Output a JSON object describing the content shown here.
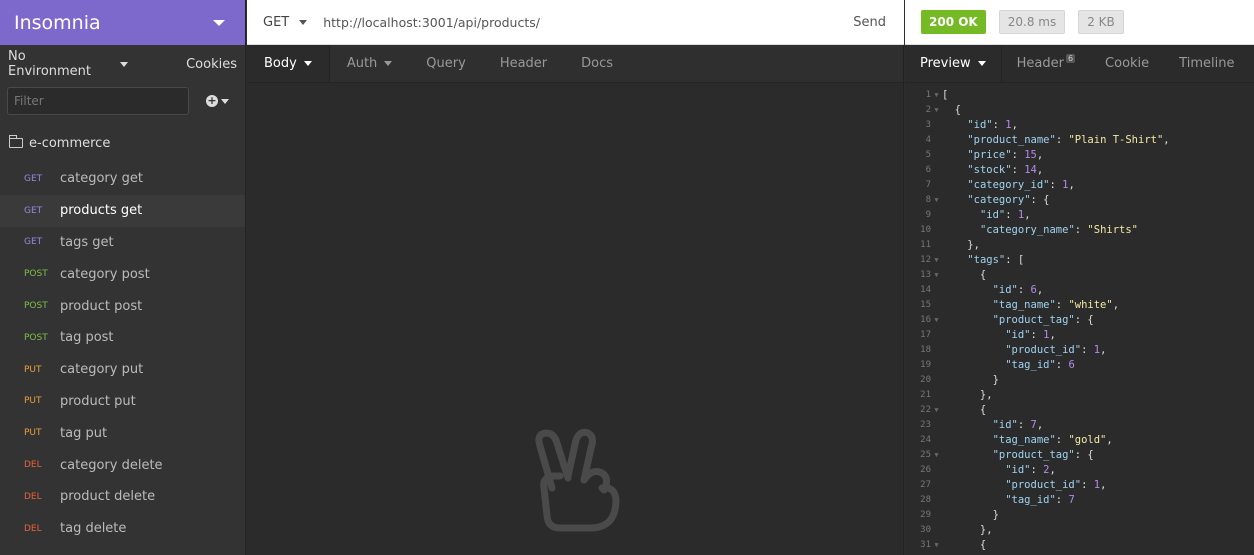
{
  "app": {
    "title": "Insomnia"
  },
  "sidebar": {
    "environment": "No Environment",
    "cookies": "Cookies",
    "filter_placeholder": "Filter",
    "folder": "e-commerce",
    "requests": [
      {
        "method": "GET",
        "name": "category get",
        "active": false
      },
      {
        "method": "GET",
        "name": "products get",
        "active": true
      },
      {
        "method": "GET",
        "name": "tags get",
        "active": false
      },
      {
        "method": "POST",
        "name": "category post",
        "active": false
      },
      {
        "method": "POST",
        "name": "product post",
        "active": false
      },
      {
        "method": "POST",
        "name": "tag post",
        "active": false
      },
      {
        "method": "PUT",
        "name": "category put",
        "active": false
      },
      {
        "method": "PUT",
        "name": "product put",
        "active": false
      },
      {
        "method": "PUT",
        "name": "tag put",
        "active": false
      },
      {
        "method": "DEL",
        "name": "category delete",
        "active": false
      },
      {
        "method": "DEL",
        "name": "product delete",
        "active": false
      },
      {
        "method": "DEL",
        "name": "tag delete",
        "active": false
      }
    ]
  },
  "request": {
    "method": "GET",
    "url": "http://localhost:3001/api/products/",
    "send_label": "Send",
    "tabs": [
      "Body",
      "Auth",
      "Query",
      "Header",
      "Docs"
    ]
  },
  "response": {
    "status": "200 OK",
    "time": "20.8 ms",
    "size": "2 KB",
    "tabs": [
      "Preview",
      "Header",
      "Cookie",
      "Timeline"
    ],
    "header_count": "6",
    "lines": [
      [
        {
          "t": "p",
          "v": "["
        }
      ],
      [
        {
          "t": "p",
          "v": "  {"
        }
      ],
      [
        {
          "t": "p",
          "v": "    "
        },
        {
          "t": "k",
          "v": "\"id\""
        },
        {
          "t": "p",
          "v": ": "
        },
        {
          "t": "n",
          "v": "1"
        },
        {
          "t": "p",
          "v": ","
        }
      ],
      [
        {
          "t": "p",
          "v": "    "
        },
        {
          "t": "k",
          "v": "\"product_name\""
        },
        {
          "t": "p",
          "v": ": "
        },
        {
          "t": "s",
          "v": "\"Plain T-Shirt\""
        },
        {
          "t": "p",
          "v": ","
        }
      ],
      [
        {
          "t": "p",
          "v": "    "
        },
        {
          "t": "k",
          "v": "\"price\""
        },
        {
          "t": "p",
          "v": ": "
        },
        {
          "t": "n",
          "v": "15"
        },
        {
          "t": "p",
          "v": ","
        }
      ],
      [
        {
          "t": "p",
          "v": "    "
        },
        {
          "t": "k",
          "v": "\"stock\""
        },
        {
          "t": "p",
          "v": ": "
        },
        {
          "t": "n",
          "v": "14"
        },
        {
          "t": "p",
          "v": ","
        }
      ],
      [
        {
          "t": "p",
          "v": "    "
        },
        {
          "t": "k",
          "v": "\"category_id\""
        },
        {
          "t": "p",
          "v": ": "
        },
        {
          "t": "n",
          "v": "1"
        },
        {
          "t": "p",
          "v": ","
        }
      ],
      [
        {
          "t": "p",
          "v": "    "
        },
        {
          "t": "k",
          "v": "\"category\""
        },
        {
          "t": "p",
          "v": ": {"
        }
      ],
      [
        {
          "t": "p",
          "v": "      "
        },
        {
          "t": "k",
          "v": "\"id\""
        },
        {
          "t": "p",
          "v": ": "
        },
        {
          "t": "n",
          "v": "1"
        },
        {
          "t": "p",
          "v": ","
        }
      ],
      [
        {
          "t": "p",
          "v": "      "
        },
        {
          "t": "k",
          "v": "\"category_name\""
        },
        {
          "t": "p",
          "v": ": "
        },
        {
          "t": "s",
          "v": "\"Shirts\""
        }
      ],
      [
        {
          "t": "p",
          "v": "    },"
        }
      ],
      [
        {
          "t": "p",
          "v": "    "
        },
        {
          "t": "k",
          "v": "\"tags\""
        },
        {
          "t": "p",
          "v": ": ["
        }
      ],
      [
        {
          "t": "p",
          "v": "      {"
        }
      ],
      [
        {
          "t": "p",
          "v": "        "
        },
        {
          "t": "k",
          "v": "\"id\""
        },
        {
          "t": "p",
          "v": ": "
        },
        {
          "t": "n",
          "v": "6"
        },
        {
          "t": "p",
          "v": ","
        }
      ],
      [
        {
          "t": "p",
          "v": "        "
        },
        {
          "t": "k",
          "v": "\"tag_name\""
        },
        {
          "t": "p",
          "v": ": "
        },
        {
          "t": "s",
          "v": "\"white\""
        },
        {
          "t": "p",
          "v": ","
        }
      ],
      [
        {
          "t": "p",
          "v": "        "
        },
        {
          "t": "k",
          "v": "\"product_tag\""
        },
        {
          "t": "p",
          "v": ": {"
        }
      ],
      [
        {
          "t": "p",
          "v": "          "
        },
        {
          "t": "k",
          "v": "\"id\""
        },
        {
          "t": "p",
          "v": ": "
        },
        {
          "t": "n",
          "v": "1"
        },
        {
          "t": "p",
          "v": ","
        }
      ],
      [
        {
          "t": "p",
          "v": "          "
        },
        {
          "t": "k",
          "v": "\"product_id\""
        },
        {
          "t": "p",
          "v": ": "
        },
        {
          "t": "n",
          "v": "1"
        },
        {
          "t": "p",
          "v": ","
        }
      ],
      [
        {
          "t": "p",
          "v": "          "
        },
        {
          "t": "k",
          "v": "\"tag_id\""
        },
        {
          "t": "p",
          "v": ": "
        },
        {
          "t": "n",
          "v": "6"
        }
      ],
      [
        {
          "t": "p",
          "v": "        }"
        }
      ],
      [
        {
          "t": "p",
          "v": "      },"
        }
      ],
      [
        {
          "t": "p",
          "v": "      {"
        }
      ],
      [
        {
          "t": "p",
          "v": "        "
        },
        {
          "t": "k",
          "v": "\"id\""
        },
        {
          "t": "p",
          "v": ": "
        },
        {
          "t": "n",
          "v": "7"
        },
        {
          "t": "p",
          "v": ","
        }
      ],
      [
        {
          "t": "p",
          "v": "        "
        },
        {
          "t": "k",
          "v": "\"tag_name\""
        },
        {
          "t": "p",
          "v": ": "
        },
        {
          "t": "s",
          "v": "\"gold\""
        },
        {
          "t": "p",
          "v": ","
        }
      ],
      [
        {
          "t": "p",
          "v": "        "
        },
        {
          "t": "k",
          "v": "\"product_tag\""
        },
        {
          "t": "p",
          "v": ": {"
        }
      ],
      [
        {
          "t": "p",
          "v": "          "
        },
        {
          "t": "k",
          "v": "\"id\""
        },
        {
          "t": "p",
          "v": ": "
        },
        {
          "t": "n",
          "v": "2"
        },
        {
          "t": "p",
          "v": ","
        }
      ],
      [
        {
          "t": "p",
          "v": "          "
        },
        {
          "t": "k",
          "v": "\"product_id\""
        },
        {
          "t": "p",
          "v": ": "
        },
        {
          "t": "n",
          "v": "1"
        },
        {
          "t": "p",
          "v": ","
        }
      ],
      [
        {
          "t": "p",
          "v": "          "
        },
        {
          "t": "k",
          "v": "\"tag_id\""
        },
        {
          "t": "p",
          "v": ": "
        },
        {
          "t": "n",
          "v": "7"
        }
      ],
      [
        {
          "t": "p",
          "v": "        }"
        }
      ],
      [
        {
          "t": "p",
          "v": "      },"
        }
      ],
      [
        {
          "t": "p",
          "v": "      {"
        }
      ]
    ],
    "foldable_lines": [
      1,
      2,
      8,
      12,
      13,
      16,
      22,
      25,
      31
    ]
  },
  "colors": {
    "brand": "#7d69cb",
    "status_ok": "#75ba24"
  }
}
